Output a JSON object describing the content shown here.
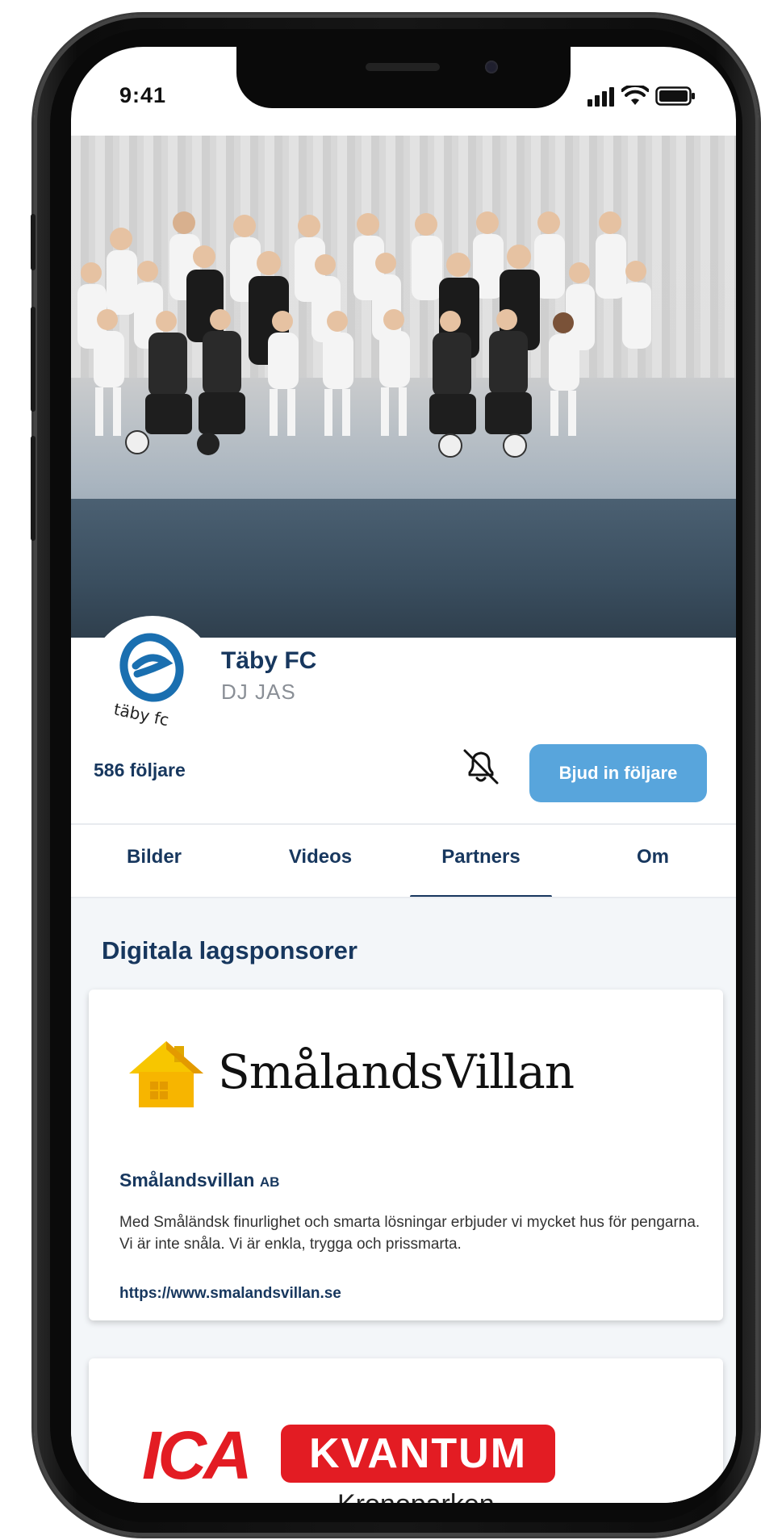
{
  "status_bar": {
    "time": "9:41"
  },
  "profile": {
    "team_name": "Täby FC",
    "team_subtitle": "DJ JAS",
    "logo_text": "täby fc",
    "followers": "586 följare",
    "invite_label": "Bjud in följare"
  },
  "tabs": [
    {
      "label": "Bilder",
      "active": false
    },
    {
      "label": "Videos",
      "active": false
    },
    {
      "label": "Partners",
      "active": true
    },
    {
      "label": "Om",
      "active": false
    }
  ],
  "section": {
    "title": "Digitala lagsponsorer"
  },
  "sponsors": [
    {
      "logo_text": "SmålandsVillan",
      "name": "Smålandsvillan",
      "name_suffix": "AB",
      "description": "Med Småländsk finurlighet och smarta lösningar erbjuder vi mycket hus för pengarna. Vi är inte snåla. Vi är enkla, trygga och prissmarta.",
      "url": "https://www.smalandsvillan.se"
    },
    {
      "logo_text_1": "ICA",
      "logo_text_2": "KVANTUM",
      "logo_text_3": "Kronoparken"
    }
  ],
  "colors": {
    "navy": "#17375e",
    "accent_blue": "#58a5dc",
    "ica_red": "#e31c23",
    "house_yellow": "#f7c600"
  },
  "icons": [
    "signal-icon",
    "wifi-icon",
    "battery-icon",
    "bell-off-icon",
    "house-icon"
  ]
}
